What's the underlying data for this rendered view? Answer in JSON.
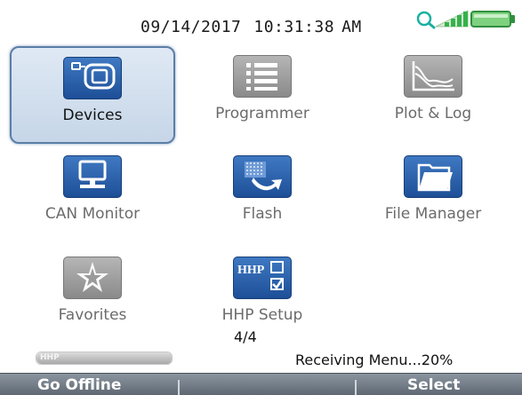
{
  "header": {
    "date": "09/14/2017",
    "time": "10:31:38",
    "ampm": "AM",
    "icons": [
      "search-icon",
      "signal-strength-icon",
      "battery-icon"
    ]
  },
  "apps": [
    {
      "label": "Devices",
      "icon": "devices-icon",
      "selected": true
    },
    {
      "label": "Programmer",
      "icon": "programmer-icon",
      "selected": false
    },
    {
      "label": "Plot & Log",
      "icon": "plot-log-icon",
      "selected": false
    },
    {
      "label": "CAN Monitor",
      "icon": "can-monitor-icon",
      "selected": false
    },
    {
      "label": "Flash",
      "icon": "flash-icon",
      "selected": false
    },
    {
      "label": "File Manager",
      "icon": "file-manager-icon",
      "selected": false
    },
    {
      "label": "Favorites",
      "icon": "favorites-icon",
      "selected": false
    },
    {
      "label": "HHP Setup",
      "icon": "hhp-setup-icon",
      "icon_text": "HHP",
      "selected": false
    }
  ],
  "page_indicator": "4/4",
  "progress": {
    "label": "HHP",
    "fraction": 1.0
  },
  "status": {
    "text": "Receiving Menu...20%"
  },
  "softkeys": {
    "left": "Go Offline",
    "right": "Select"
  },
  "colors": {
    "accent_blue": "#2a5fa8",
    "selected_border": "#5a7ea7",
    "softkey_bar": "#6c7580",
    "signal_green": "#35b24a"
  }
}
